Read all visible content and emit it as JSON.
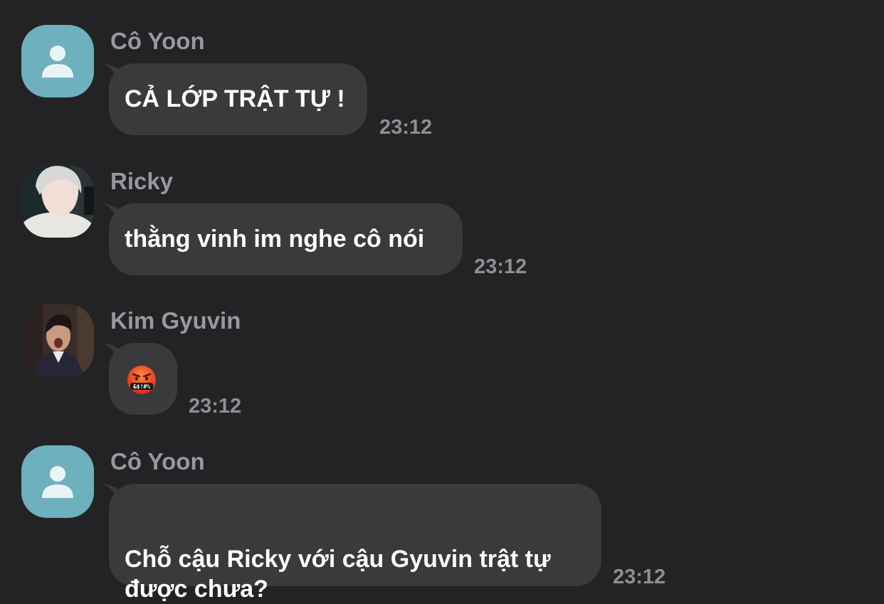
{
  "messages": [
    {
      "sender": "Cô Yoon",
      "avatar": "default-person-icon",
      "text": "CẢ LỚP TRẬT TỰ !",
      "time": "23:12"
    },
    {
      "sender": "Ricky",
      "avatar": "photo",
      "text": "thằng vinh im nghe cô nói",
      "time": "23:12"
    },
    {
      "sender": "Kim Gyuvin",
      "avatar": "photo",
      "text": "",
      "emoji": "face-with-symbols-on-mouth",
      "emoji_symbols": "&$!#%",
      "time": "23:12"
    },
    {
      "sender": "Cô Yoon",
      "avatar": "default-person-icon",
      "text_line1": "Chỗ cậu Ricky với cậu Gyuvin trật tự",
      "text_line2": "được chưa?",
      "time": "23:12"
    }
  ],
  "colors": {
    "background": "#232325",
    "bubble": "#3a3a3c",
    "sender": "#98989e",
    "time": "#8e8e93",
    "default_avatar": "#6fb0bf"
  }
}
